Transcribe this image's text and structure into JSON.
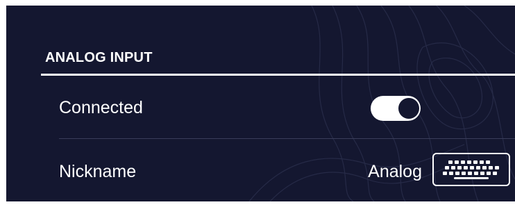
{
  "section": {
    "title": "ANALOG INPUT"
  },
  "rows": [
    {
      "label": "Connected",
      "control": "toggle",
      "toggle_on": true
    },
    {
      "label": "Nickname",
      "value": "Analog",
      "control_icon": "keyboard-icon"
    }
  ],
  "colors": {
    "background": "#141730",
    "foreground": "#ffffff",
    "divider": "#3a3d5a"
  }
}
